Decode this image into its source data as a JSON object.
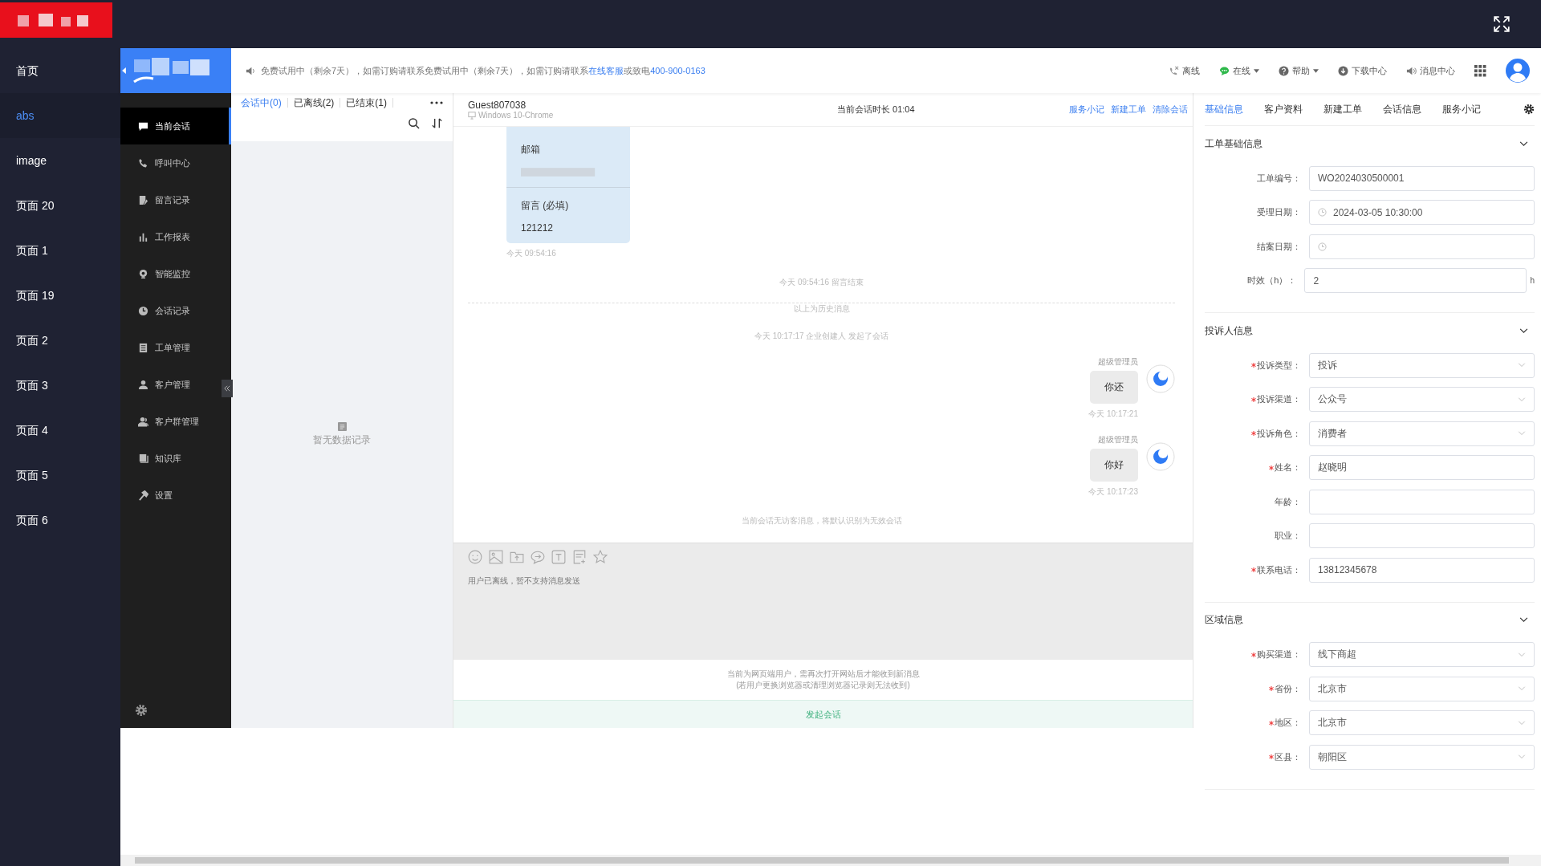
{
  "nav": [
    {
      "label": "首页",
      "selected": false
    },
    {
      "label": "abs",
      "selected": true
    },
    {
      "label": "image",
      "selected": false
    },
    {
      "label": "页面 20",
      "selected": false
    },
    {
      "label": "页面 1",
      "selected": false
    },
    {
      "label": "页面 19",
      "selected": false
    },
    {
      "label": "页面 2",
      "selected": false
    },
    {
      "label": "页面 3",
      "selected": false
    },
    {
      "label": "页面 4",
      "selected": false
    },
    {
      "label": "页面 5",
      "selected": false
    },
    {
      "label": "页面 6",
      "selected": false
    }
  ],
  "notice": {
    "text": "免费试用中（剩余7天），如需订购请联系免费试用中（剩余7天），如需订购请联系",
    "link": "在线客服",
    "middle": "或致电",
    "phone": "400-900-0163"
  },
  "toolbar": [
    {
      "kind": "offline",
      "label": "离线",
      "dropdown": false
    },
    {
      "kind": "online",
      "label": "在线",
      "dropdown": true
    },
    {
      "kind": "help",
      "label": "帮助",
      "dropdown": true
    },
    {
      "kind": "download",
      "label": "下载中心",
      "dropdown": false
    },
    {
      "kind": "message",
      "label": "消息中心",
      "dropdown": false
    }
  ],
  "menu": [
    {
      "kind": "chat",
      "label": "当前会话",
      "selected": true
    },
    {
      "kind": "phone",
      "label": "呼叫中心",
      "selected": false
    },
    {
      "kind": "note",
      "label": "留言记录",
      "selected": false
    },
    {
      "kind": "chart",
      "label": "工作报表",
      "selected": false
    },
    {
      "kind": "monitor",
      "label": "智能监控",
      "selected": false
    },
    {
      "kind": "clock",
      "label": "会话记录",
      "selected": false
    },
    {
      "kind": "doc",
      "label": "工单管理",
      "selected": false
    },
    {
      "kind": "user",
      "label": "客户管理",
      "selected": false
    },
    {
      "kind": "group",
      "label": "客户群管理",
      "selected": false
    },
    {
      "kind": "book",
      "label": "知识库",
      "selected": false
    },
    {
      "kind": "hammer",
      "label": "设置",
      "selected": false
    }
  ],
  "session_tabs": [
    {
      "label": "会话中(0)",
      "selected": true
    },
    {
      "label": "已离线(2)",
      "selected": false
    },
    {
      "label": "已结束(1)",
      "selected": false
    }
  ],
  "empty_list": "暂无数据记录",
  "chat": {
    "guest": "Guest807038",
    "device": "Windows 10-Chrome",
    "duration": "当前会话时长 01:04",
    "actions": [
      "服务小记",
      "新建工单",
      "清除会话"
    ],
    "messages": [
      {
        "kind": "form_card",
        "fields": [
          {
            "label": "邮箱",
            "redacted": true
          },
          {
            "label": "留言 (必填)",
            "value": "121212",
            "redacted": false
          }
        ],
        "time": "今天 09:54:16"
      },
      {
        "kind": "system",
        "text": "今天 09:54:16  留言结束"
      },
      {
        "kind": "divider",
        "text": "以上为历史消息"
      },
      {
        "kind": "system",
        "text": "今天 10:17:17  企业创建人 发起了会话"
      },
      {
        "kind": "agent",
        "sender": "超级管理员",
        "text": "你还",
        "time": "今天 10:17:21"
      },
      {
        "kind": "agent",
        "sender": "超级管理员",
        "text": "你好",
        "time": "今天 10:17:23"
      },
      {
        "kind": "system",
        "text": "当前会话无访客消息，将默认识别为无效会话"
      }
    ]
  },
  "composer": {
    "status": "用户已离线，暂不支持消息发送"
  },
  "web_notice": [
    "当前为网页端用户，需再次打开网站后才能收到新消息",
    "(若用户更换浏览器或清理浏览器记录则无法收到)"
  ],
  "start_button": "发起会话",
  "panel": {
    "tabs": [
      {
        "label": "基础信息",
        "selected": true
      },
      {
        "label": "客户资料",
        "selected": false
      },
      {
        "label": "新建工单",
        "selected": false
      },
      {
        "label": "会话信息",
        "selected": false
      },
      {
        "label": "服务小记",
        "selected": false
      }
    ],
    "sections": [
      {
        "title": "工单基础信息",
        "expanded": true,
        "fields": [
          {
            "label": "工单编号：",
            "required": false,
            "kind": "text",
            "value": "WO2024030500001"
          },
          {
            "label": "受理日期：",
            "required": false,
            "kind": "date",
            "value": "2024-03-05 10:30:00"
          },
          {
            "label": "结案日期：",
            "required": false,
            "kind": "date"
          },
          {
            "label": "时效（h）：",
            "required": false,
            "kind": "text",
            "value": "2",
            "suffix": "h"
          }
        ]
      },
      {
        "title": "投诉人信息",
        "expanded": true,
        "fields": [
          {
            "label": "投诉类型：",
            "required": true,
            "kind": "select",
            "value": "投诉"
          },
          {
            "label": "投诉渠道：",
            "required": true,
            "kind": "select",
            "value": "公众号"
          },
          {
            "label": "投诉角色：",
            "required": true,
            "kind": "select",
            "value": "消费者"
          },
          {
            "label": "姓名：",
            "required": true,
            "kind": "text",
            "value": "赵晓明"
          },
          {
            "label": "年龄：",
            "required": false,
            "kind": "text"
          },
          {
            "label": "职业：",
            "required": false,
            "kind": "text"
          },
          {
            "label": "联系电话：",
            "required": true,
            "kind": "text",
            "value": "13812345678"
          }
        ]
      },
      {
        "title": "区域信息",
        "expanded": true,
        "fields": [
          {
            "label": "购买渠道：",
            "required": true,
            "kind": "select",
            "value": "线下商超"
          },
          {
            "label": "省份：",
            "required": true,
            "kind": "select",
            "value": "北京市"
          },
          {
            "label": "地区：",
            "required": true,
            "kind": "select",
            "value": "北京市"
          },
          {
            "label": "区县：",
            "required": true,
            "kind": "select",
            "value": "朝阳区"
          }
        ]
      }
    ]
  }
}
